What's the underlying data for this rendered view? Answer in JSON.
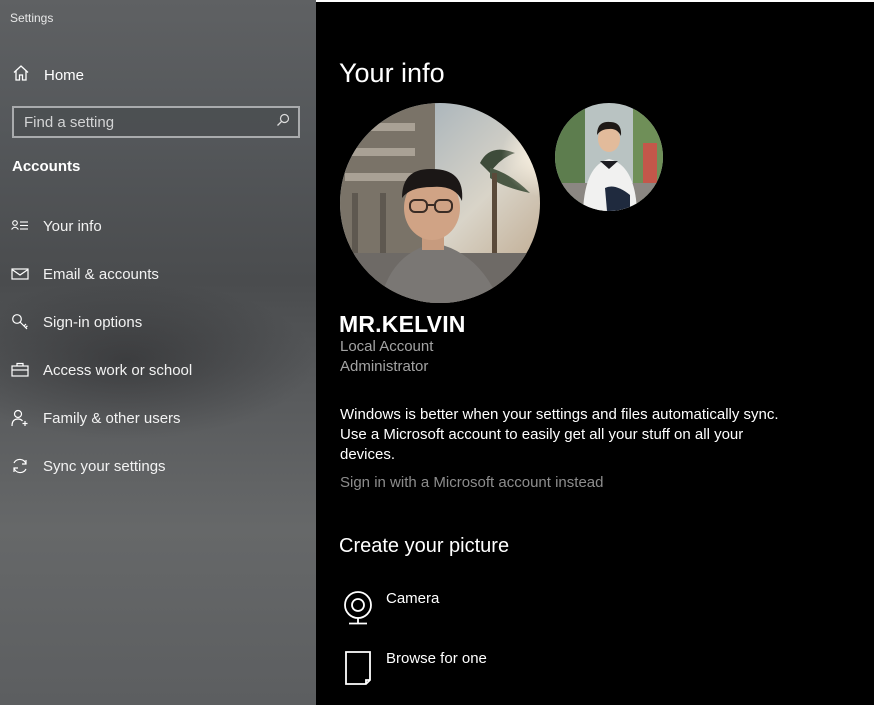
{
  "window": {
    "title": "Settings"
  },
  "sidebar": {
    "home_label": "Home",
    "search": {
      "placeholder": "Find a setting"
    },
    "section_title": "Accounts",
    "items": [
      {
        "label": "Your info",
        "icon": "person-card-icon"
      },
      {
        "label": "Email & accounts",
        "icon": "envelope-icon"
      },
      {
        "label": "Sign-in options",
        "icon": "key-icon"
      },
      {
        "label": "Access work or school",
        "icon": "briefcase-icon"
      },
      {
        "label": "Family & other users",
        "icon": "person-add-icon"
      },
      {
        "label": "Sync your settings",
        "icon": "sync-icon"
      }
    ]
  },
  "main": {
    "title": "Your info",
    "user": {
      "name": "MR.KELVIN",
      "account_type": "Local Account",
      "role": "Administrator"
    },
    "sync_message": "Windows is better when your settings and files automatically sync. Use a Microsoft account to easily get all your stuff on all your devices.",
    "ms_link": "Sign in with a Microsoft account instead",
    "create_picture": {
      "title": "Create your picture",
      "options": [
        {
          "label": "Camera",
          "icon": "camera-icon"
        },
        {
          "label": "Browse for one",
          "icon": "browse-file-icon"
        }
      ]
    }
  },
  "colors": {
    "sidebar_bg": "#55585b",
    "main_bg": "#000000",
    "meta_text": "#a3a3a3",
    "link_text": "#8d8d8d"
  }
}
